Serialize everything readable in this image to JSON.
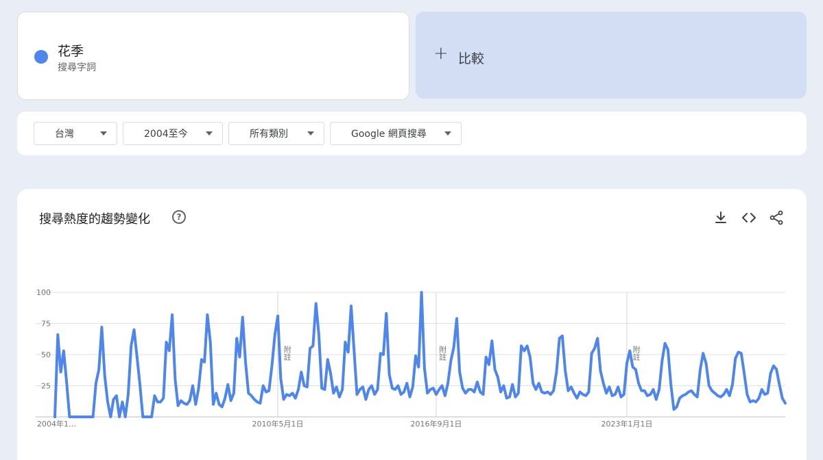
{
  "search_term": {
    "name": "花季",
    "sublabel": "搜尋字詞",
    "color": "#4e86ec"
  },
  "compare": {
    "label": "比較"
  },
  "filters": [
    {
      "label": "台灣"
    },
    {
      "label": "2004至今"
    },
    {
      "label": "所有類別"
    },
    {
      "label": "Google 網頁搜尋"
    }
  ],
  "chart_section": {
    "title": "搜尋熱度的趨勢變化",
    "help_icon": "help-circle-icon",
    "toolbar_icons": [
      "download-icon",
      "embed-code-icon",
      "share-icon"
    ]
  },
  "chart_data": {
    "type": "line",
    "title": "",
    "xlabel": "",
    "ylabel": "",
    "ylim": [
      0,
      100
    ],
    "y_ticks": [
      "100",
      "75",
      "50",
      "25"
    ],
    "x_tick_labels": [
      "2004年1…",
      "2010年5月1日",
      "2016年9月1日",
      "2023年1月1日"
    ],
    "note_marker_label": "附註",
    "grid": true,
    "line_color": "#4e86ec",
    "series": [
      {
        "values": [
          0,
          66,
          36,
          53,
          28,
          0,
          0,
          0,
          0,
          0,
          0,
          0,
          0,
          0,
          27,
          38,
          72,
          33,
          12,
          0,
          14,
          17,
          0,
          12,
          0,
          18,
          57,
          70,
          48,
          26,
          0,
          0,
          0,
          0,
          17,
          12,
          12,
          15,
          60,
          53,
          82,
          30,
          9,
          13,
          11,
          10,
          13,
          25,
          10,
          23,
          46,
          44,
          82,
          60,
          10,
          19,
          10,
          8,
          15,
          26,
          13,
          19,
          63,
          48,
          80,
          44,
          19,
          17,
          14,
          12,
          11,
          25,
          20,
          21,
          41,
          66,
          81,
          31,
          14,
          18,
          17,
          19,
          15,
          22,
          36,
          25,
          24,
          55,
          57,
          91,
          66,
          23,
          22,
          46,
          35,
          19,
          24,
          16,
          22,
          60,
          52,
          89,
          53,
          18,
          22,
          24,
          14,
          22,
          25,
          18,
          22,
          51,
          50,
          83,
          34,
          23,
          22,
          25,
          18,
          20,
          27,
          16,
          24,
          49,
          40,
          100,
          39,
          19,
          22,
          23,
          18,
          22,
          25,
          17,
          27,
          45,
          56,
          79,
          36,
          23,
          19,
          22,
          22,
          20,
          28,
          20,
          18,
          48,
          42,
          61,
          38,
          32,
          20,
          25,
          15,
          16,
          26,
          16,
          19,
          57,
          53,
          57,
          48,
          27,
          22,
          27,
          20,
          19,
          20,
          18,
          21,
          36,
          63,
          65,
          37,
          21,
          24,
          19,
          15,
          20,
          18,
          17,
          20,
          51,
          55,
          63,
          37,
          27,
          19,
          24,
          17,
          18,
          24,
          16,
          18,
          43,
          53,
          40,
          38,
          27,
          21,
          21,
          17,
          18,
          22,
          14,
          22,
          45,
          59,
          54,
          26,
          6,
          8,
          15,
          17,
          18,
          20,
          21,
          18,
          16,
          38,
          51,
          43,
          25,
          21,
          19,
          17,
          16,
          18,
          22,
          17,
          26,
          47,
          52,
          51,
          35,
          18,
          12,
          13,
          12,
          15,
          22,
          18,
          19,
          35,
          41,
          38,
          26,
          15,
          11
        ]
      }
    ]
  }
}
